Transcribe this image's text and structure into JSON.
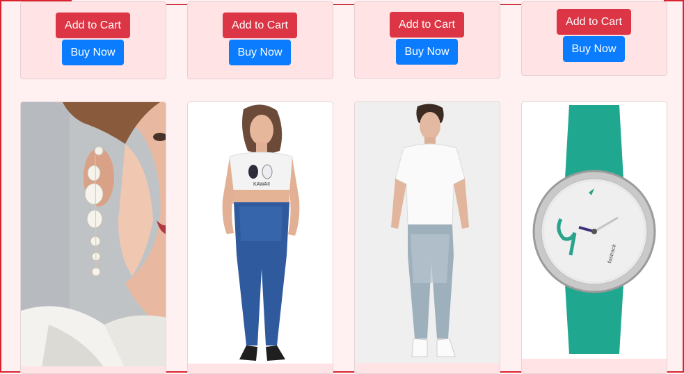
{
  "colors": {
    "page_bg": "#fff0f1",
    "card_bg": "#ffe3e5",
    "add_to_cart": "#dc3545",
    "buy_now": "#0a7cfd",
    "outer_border": "#d9232e"
  },
  "top_row": [
    {
      "add_to_cart": "Add to Cart",
      "buy_now": "Buy Now"
    },
    {
      "add_to_cart": "Add to Cart",
      "buy_now": "Buy Now"
    },
    {
      "add_to_cart": "Add to Cart",
      "buy_now": "Buy Now"
    },
    {
      "add_to_cart": "Add to Cart",
      "buy_now": "Buy Now"
    }
  ],
  "products": [
    {
      "image": "pearl-drop-earrings-photo"
    },
    {
      "image": "crop-top-and-jeans-photo",
      "print_text": "KAWAII"
    },
    {
      "image": "white-tee-and-jeans-photo"
    },
    {
      "image": "green-strap-wristwatch-photo",
      "brand_text": "fastrack"
    }
  ]
}
